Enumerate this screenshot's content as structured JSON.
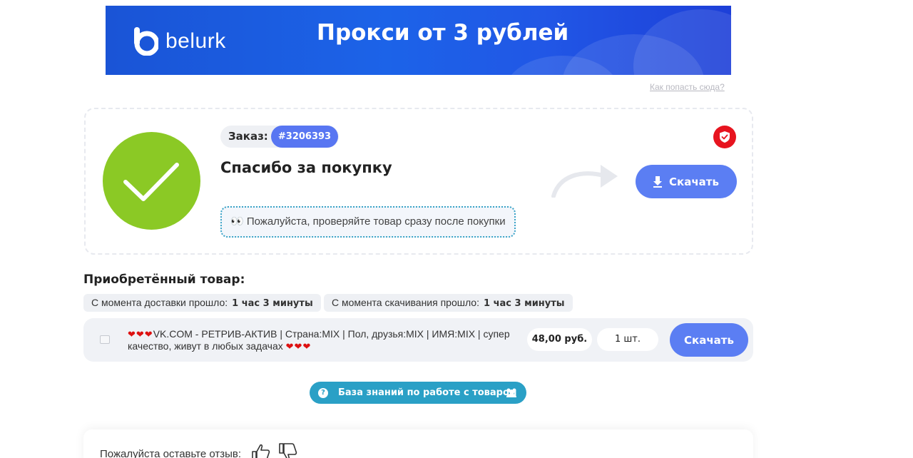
{
  "banner": {
    "logo_text": "belurk",
    "headline": "Прокси от 3 рублей",
    "how_link": "Как попасть сюда?"
  },
  "order": {
    "label": "Заказ:",
    "number": "#3206393",
    "title": "Спасибо за покупку",
    "note": "👀 Пожалуйста, проверяйте товар сразу после покупки",
    "download_label": "Скачать",
    "colors": {
      "success": "#8bc925",
      "accent": "#5b7ef3",
      "badge": "#e7141f"
    }
  },
  "purchased": {
    "title": "Приобретённый товар:",
    "since_delivery_label": "С момента доставки прошло:",
    "since_delivery_value": "1 час 3 минуты",
    "since_download_label": "С момента скачивания прошло:",
    "since_download_value": "1 час 3 минуты",
    "product": {
      "hearts_lead": "❤❤❤",
      "title_line1": "VK.COM - РЕТРИВ-АКТИВ | Страна:MIX | Пол, друзья:MIX | ИМЯ:MIX | супер",
      "title_line2": "качество, живут в любых задачах",
      "hearts_tail": "❤❤❤",
      "price": "48,00 руб.",
      "quantity": "1 шт.",
      "download_label": "Скачать"
    }
  },
  "knowledge_base": {
    "label": "База знаний по работе с товаром"
  },
  "review": {
    "label": "Пожалуйста оставьте отзыв:"
  }
}
